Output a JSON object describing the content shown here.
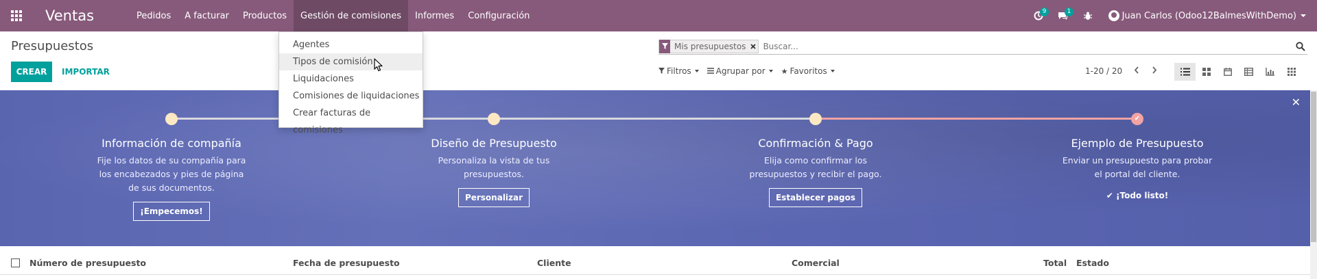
{
  "navbar": {
    "brand": "Ventas",
    "menu": [
      "Pedidos",
      "A facturar",
      "Productos",
      "Gestión de comisiones",
      "Informes",
      "Configuración"
    ],
    "active_menu": "Gestión de comisiones",
    "activity_count": "9",
    "messages_count": "1",
    "user_name": "Juan Carlos (Odoo12BalmesWithDemo)"
  },
  "dropdown": {
    "items": [
      "Agentes",
      "Tipos de comisión",
      "Liquidaciones",
      "Comisiones de liquidaciones",
      "Crear facturas de comisiones"
    ],
    "hovered": "Tipos de comisión"
  },
  "control": {
    "title": "Presupuestos",
    "create_label": "CREAR",
    "import_label": "IMPORTAR",
    "facet_label": "Mis presupuestos",
    "search_placeholder": "Buscar...",
    "filters_label": "Filtros",
    "group_label": "Agrupar por",
    "favorites_label": "Favoritos",
    "pager": "1-20 / 20"
  },
  "banner": {
    "steps": [
      {
        "title": "Información de compañía",
        "desc": [
          "Fije los datos de su compañía para",
          "los encabezados y pies de página",
          "de sus documentos."
        ],
        "action": "¡Empecemos!"
      },
      {
        "title": "Diseño de Presupuesto",
        "desc": [
          "Personaliza la vista de tus",
          "presupuestos."
        ],
        "action": "Personalizar"
      },
      {
        "title": "Confirmación & Pago",
        "desc": [
          "Elija como confirmar los",
          "presupuestos y recibir el pago."
        ],
        "action": "Establecer pagos"
      },
      {
        "title": "Ejemplo de Presupuesto",
        "desc": [
          "Enviar un presupuesto para probar",
          "el portal del cliente."
        ],
        "done": "¡Todo listo!"
      }
    ]
  },
  "list": {
    "columns": [
      "Número de presupuesto",
      "Fecha de presupuesto",
      "Cliente",
      "Comercial",
      "Total",
      "Estado"
    ]
  },
  "colors": {
    "navbar": "#875a7b",
    "primary": "#00a09d",
    "banner": "#5b66b2"
  }
}
